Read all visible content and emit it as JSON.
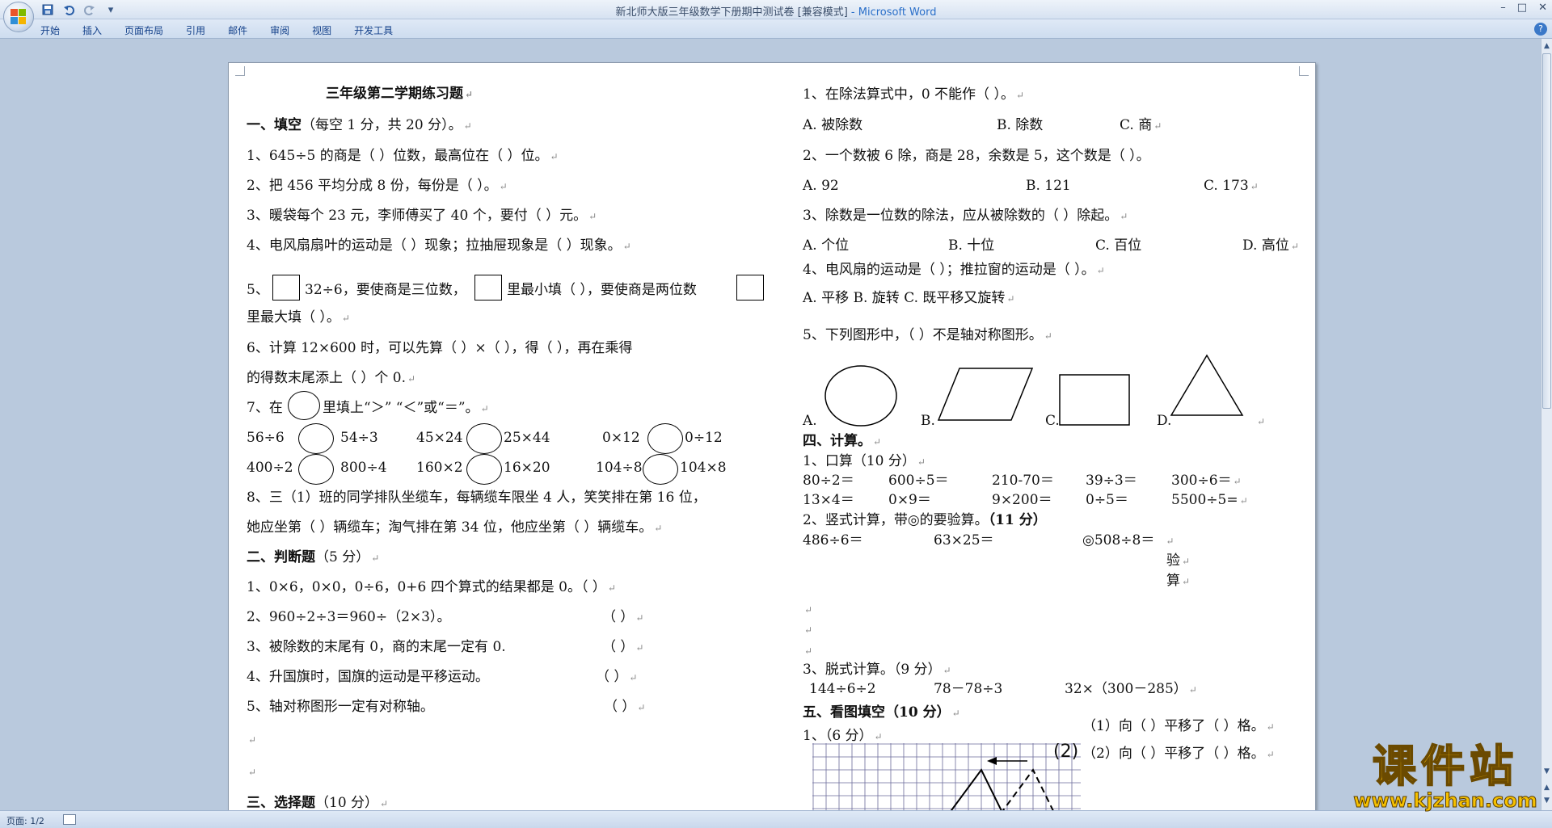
{
  "window": {
    "title": "新北师大版三年级数学下册期中测试卷 [兼容模式]",
    "app_name": " - Microsoft Word",
    "minimize": "–",
    "maximize": "□",
    "close": "✕"
  },
  "qat": {
    "save_icon": "save-icon",
    "undo_icon": "undo-icon",
    "redo_icon": "redo-icon",
    "more": "▾"
  },
  "ribbon_tabs": [
    "开始",
    "插入",
    "页面布局",
    "引用",
    "邮件",
    "审阅",
    "视图",
    "开发工具"
  ],
  "help": "?",
  "doc": {
    "left": {
      "title": "三年级第二学期练习题",
      "s1_head": "一、填空",
      "s1_note": "（每空 1 分，共 20 分）。",
      "q1": "1、645÷5 的商是（    ）位数，最高位在（    ）位。",
      "q2": "2、把 456 平均分成 8 份，每份是（      ）。",
      "q3": "3、暖袋每个 23 元，李师傅买了 40 个，要付（     ）元。",
      "q4": "4、电风扇扇叶的运动是（      ）现象；拉抽屉现象是（    ）现象。",
      "q5_prefix": "5、",
      "q5_mid1": "32÷6，要使商是三位数，",
      "q5_mid2": "里最小填（    ），要使商是两位数",
      "q5_cont": "里最大填（      ）。",
      "q6": "6、计算 12×600 时，可以先算（    ）×（    ），得（     ），再在乘得",
      "q6_cont": "的得数末尾添上（    ）个 0.",
      "q7_prefix": "7、在",
      "q7_suffix": "里填上“＞”  “＜”或“＝”。",
      "c1a": "56÷6",
      "c1b": "54÷3",
      "c2a": "45×24",
      "c2b": "25×44",
      "c3a": "0×12",
      "c3b": "0÷12",
      "c4a": "400÷2",
      "c4b": "800÷4",
      "c5a": "160×2",
      "c5b": "16×20",
      "c6a": "104÷8",
      "c6b": "104×8",
      "q8": "8、三（1）班的同学排队坐缆车，每辆缆车限坐 4 人，笑笑排在第 16 位，",
      "q8_cont": "她应坐第（    ）辆缆车；淘气排在第 34 位，他应坐第（    ）辆缆车。",
      "s2_head": "二、判断题",
      "s2_note": "（5 分）",
      "j1": "1、0×6，0×0，0÷6，0+6 四个算式的结果都是 0。（     ）",
      "j2": "2、960÷2÷3＝960÷（2×3）。",
      "j2_paren": "（     ）",
      "j3": "3、被除数的末尾有 0，商的末尾一定有 0.",
      "j3_paren": "（     ）",
      "j4": "4、升国旗时，国旗的运动是平移运动。",
      "j4_paren": "（     ）",
      "j5": "5、轴对称图形一定有对称轴。",
      "j5_paren": "（     ）",
      "s3_head": "三、选择题",
      "s3_note": "（10 分）"
    },
    "right": {
      "r1": "1、在除法算式中，0 不能作（       ）。",
      "r1a": "A. 被除数",
      "r1b": "B. 除数",
      "r1c": "C. 商",
      "r2": "2、一个数被 6 除，商是 28，余数是 5，这个数是（        ）。",
      "r2a": "A. 92",
      "r2b": "B. 121",
      "r2c": "C. 173",
      "r3": "3、除数是一位数的除法，应从被除数的（       ）除起。",
      "r3a": "A. 个位",
      "r3b": "B. 十位",
      "r3c": "C. 百位",
      "r3d": "D. 高位",
      "r4": "4、电风扇的运动是（       ）；推拉窗的运动是（       ）。",
      "r4opts": "A. 平移   B. 旋转   C. 既平移又旋转",
      "r5": "5、下列图形中，（      ）不是轴对称图形。",
      "shapeA": "A.",
      "shapeB": "B.",
      "shapeC": "C.",
      "shapeD": "D.",
      "s4_head": "四、计算。",
      "k1": "1、口算（10 分）",
      "k1_r1": [
        "80÷2＝",
        "600÷5＝",
        "210-70＝",
        "39÷3＝",
        "300÷6＝"
      ],
      "k1_r2": [
        "13×4＝",
        "0×9＝",
        "9×200＝",
        "0÷5＝",
        "5500÷5="
      ],
      "k2": "2、竖式计算，带◎的要验算。",
      "k2_score": "（11 分）",
      "k2_items": [
        "486÷6＝",
        "63×25＝",
        "◎508÷8＝"
      ],
      "k2_check1": "验",
      "k2_check2": "算",
      "k3": "3、脱式计算。（9 分）",
      "k3_items": [
        "144÷6÷2",
        "78－78÷3",
        "32×（300－285）"
      ],
      "s5_head": "五、看图填空（10 分）",
      "g1": "1、（6 分）",
      "g_l1": "（1）向（    ）平移了（    ）格。",
      "g_l2": "（2）向（    ）平移了（    ）格。",
      "g_label": "(2)"
    }
  },
  "status": {
    "page": "页面: 1/2"
  },
  "watermark": {
    "brand": "课件站",
    "url": "www.kjzhan.com"
  }
}
